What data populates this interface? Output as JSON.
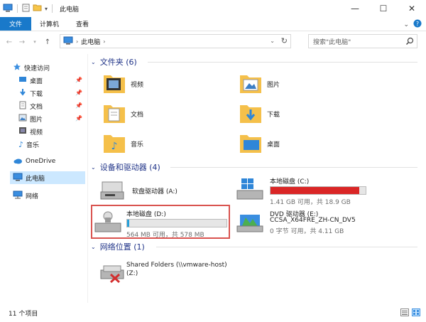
{
  "window": {
    "title": "此电脑",
    "controls": {
      "minimize": "—",
      "maximize": "☐",
      "close": "✕"
    }
  },
  "ribbon": {
    "tabs": [
      "文件",
      "计算机",
      "查看"
    ],
    "expand_icon": "chevron-down-icon",
    "help_icon": "help-icon"
  },
  "address": {
    "crumb": "此电脑",
    "search_placeholder": "搜索\"此电脑\""
  },
  "nav": {
    "quick_access": "快速访问",
    "quick_items": [
      "桌面",
      "下载",
      "文档",
      "图片",
      "视频",
      "音乐"
    ],
    "onedrive": "OneDrive",
    "this_pc": "此电脑",
    "network": "网络"
  },
  "groups": {
    "folders": "文件夹 (6)",
    "devices": "设备和驱动器 (4)",
    "network": "网络位置 (1)"
  },
  "folders": [
    "视频",
    "图片",
    "文档",
    "下载",
    "音乐",
    "桌面"
  ],
  "drives": [
    {
      "name": "软盘驱动器 (A:)",
      "info": ""
    },
    {
      "name": "本地磁盘 (C:)",
      "info": "1.41 GB 可用，共 18.9 GB",
      "used_fraction": 0.93,
      "color": "#da2626"
    },
    {
      "name": "本地磁盘 (D:)",
      "info": "564 MB 可用，共 578 MB",
      "used_fraction": 0.02,
      "color": "#26a0da"
    },
    {
      "name": "DVD 驱动器 (E:)",
      "subname": "CCSA_X64FRE_ZH-CN_DV5",
      "info": "0 字节 可用，共 4.11 GB"
    }
  ],
  "network_locations": [
    {
      "name": "Shared Folders (\\\\vmware-host)",
      "subname": "(Z:)"
    }
  ],
  "status": {
    "items": "11 个项目"
  }
}
